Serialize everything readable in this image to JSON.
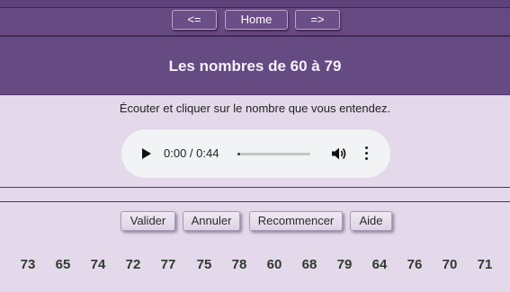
{
  "nav": {
    "prev_label": "<=",
    "home_label": "Home",
    "next_label": "=>"
  },
  "title": "Les nombres de 60 à 79",
  "instruction": "Écouter et cliquer sur le nombre que vous entendez.",
  "audio": {
    "time": "0:00 / 0:44",
    "progress": 0.0
  },
  "actions": {
    "validate_label": "Valider",
    "cancel_label": "Annuler",
    "restart_label": "Recommencer",
    "help_label": "Aide"
  },
  "numbers": [
    "73",
    "65",
    "74",
    "72",
    "77",
    "75",
    "78",
    "60",
    "68",
    "79",
    "64",
    "76",
    "70",
    "71"
  ],
  "colors": {
    "header_purple": "#664a82",
    "page_background": "#e3d9ea",
    "title_text": "#f7f1fb",
    "number_text": "#2f3a2f"
  },
  "icons": {
    "play": "play-icon",
    "volume": "volume-icon",
    "more": "more-options-icon"
  }
}
